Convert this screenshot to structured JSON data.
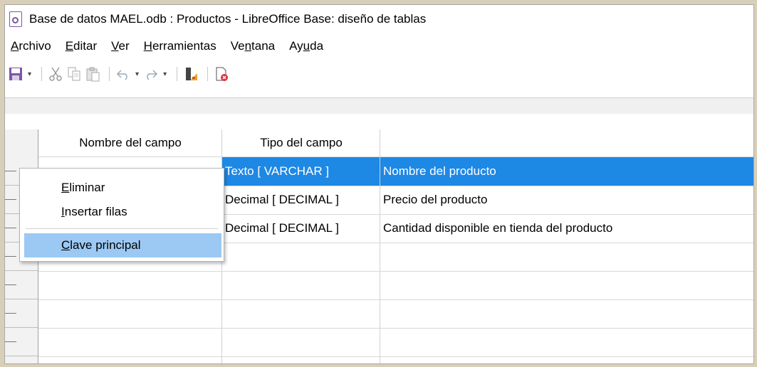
{
  "window": {
    "title": "Base de datos MAEL.odb : Productos - LibreOffice Base: diseño de tablas"
  },
  "menu": {
    "items": [
      {
        "ul": "A",
        "rest": "rchivo"
      },
      {
        "ul": "E",
        "rest": "ditar"
      },
      {
        "ul": "V",
        "rest": "er"
      },
      {
        "ul": "H",
        "rest": "erramientas"
      },
      {
        "pre": "Ve",
        "ul": "n",
        "rest": "tana"
      },
      {
        "pre": "Ay",
        "ul": "u",
        "rest": "da"
      }
    ]
  },
  "toolbar": {
    "icons": [
      "save-icon",
      "cut-icon",
      "copy-icon",
      "paste-icon",
      "undo-icon",
      "redo-icon",
      "primary-key-icon",
      "index-design-icon"
    ]
  },
  "table": {
    "headers": [
      "Nombre del campo",
      "Tipo del campo",
      ""
    ],
    "rows": [
      {
        "name": "",
        "type": "Texto [ VARCHAR ]",
        "description": "Nombre del producto",
        "selected": true
      },
      {
        "name": "",
        "type": "Decimal [ DECIMAL ]",
        "description": "Precio del producto",
        "selected": false
      },
      {
        "name": "",
        "type": "Decimal [ DECIMAL ]",
        "description": "Cantidad disponible en tienda del producto",
        "selected": false
      },
      {
        "name": "",
        "type": "",
        "description": "",
        "selected": false
      },
      {
        "name": "",
        "type": "",
        "description": "",
        "selected": false
      },
      {
        "name": "",
        "type": "",
        "description": "",
        "selected": false
      },
      {
        "name": "",
        "type": "",
        "description": "",
        "selected": false
      }
    ]
  },
  "context_menu": {
    "items": [
      {
        "ul": "E",
        "rest": "liminar",
        "active": false
      },
      {
        "ul": "I",
        "rest": "nsertar filas",
        "active": false
      },
      {
        "ul": "C",
        "rest": "lave principal",
        "active": true
      }
    ]
  },
  "colors": {
    "selection": "#1e88e5",
    "menu_highlight": "#9cc9f3",
    "app_accent": "#7b57a6"
  }
}
